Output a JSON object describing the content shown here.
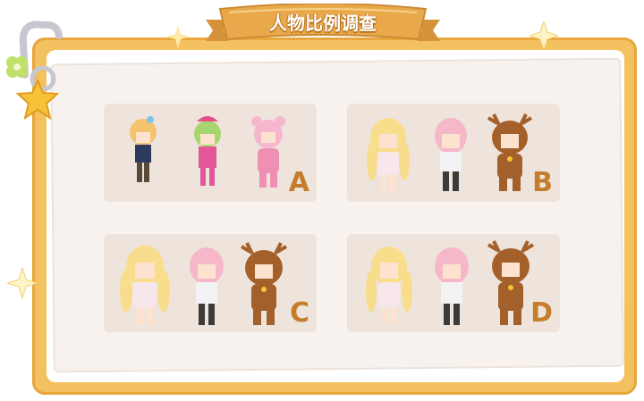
{
  "title": "人物比例调查",
  "options": [
    {
      "letter": "A"
    },
    {
      "letter": "B"
    },
    {
      "letter": "C"
    },
    {
      "letter": "D"
    }
  ],
  "colors": {
    "frame": "#f4c160",
    "frame_border": "#e8a63c",
    "paper": "#f7f2ee",
    "panel": "#efe4dc",
    "letter": "#c47d2a",
    "banner": "#e9a94a"
  },
  "icons": [
    "clip-icon",
    "star-icon",
    "clover-icon",
    "sparkle-icon"
  ]
}
